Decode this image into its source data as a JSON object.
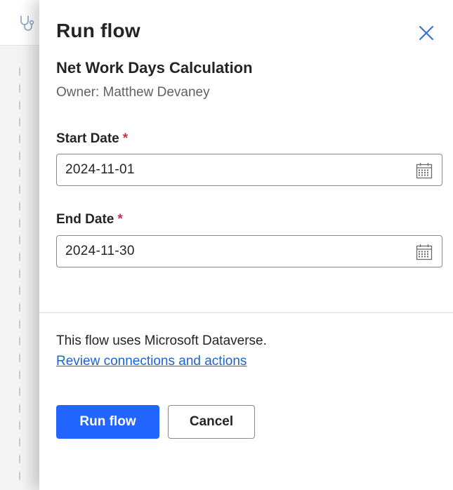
{
  "panel": {
    "title": "Run flow",
    "flow_name": "Net Work Days Calculation",
    "owner_label": "Owner: ",
    "owner_name": "Matthew Devaney"
  },
  "fields": [
    {
      "label": "Start Date",
      "required_marker": "*",
      "value": "2024-11-01",
      "icon": "calendar-icon"
    },
    {
      "label": "End Date",
      "required_marker": "*",
      "value": "2024-11-30",
      "icon": "calendar-icon"
    }
  ],
  "footer": {
    "info_text": "This flow uses Microsoft Dataverse.",
    "review_link": "Review connections and actions"
  },
  "actions": {
    "run_label": "Run flow",
    "cancel_label": "Cancel"
  },
  "icons": {
    "close": "close-icon",
    "background": "stethoscope-icon"
  },
  "colors": {
    "primary": "#2266ff",
    "link": "#1a64d3",
    "required": "#c4314b",
    "close_icon": "#2f6fd6"
  }
}
